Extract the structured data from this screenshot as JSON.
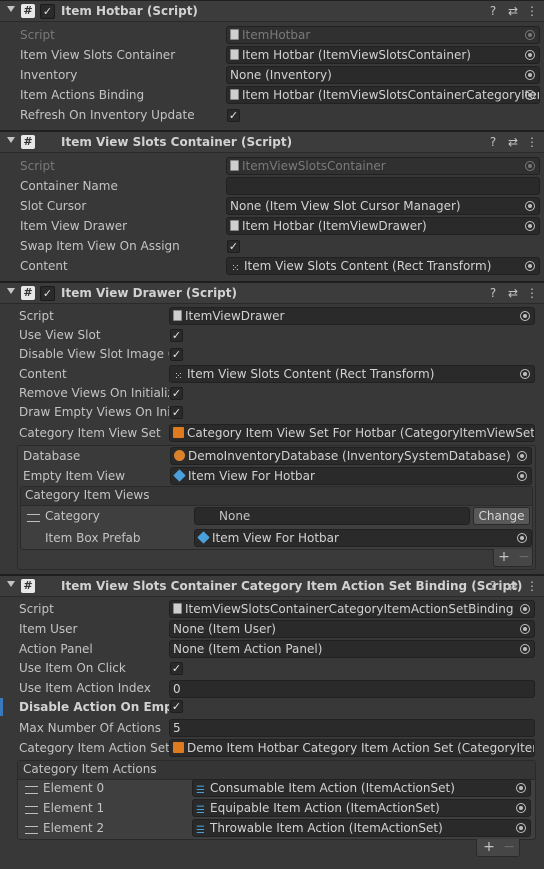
{
  "c1": {
    "title": "Item Hotbar (Script)",
    "rows": [
      {
        "label": "Script",
        "value": "ItemHotbar"
      },
      {
        "label": "Item View Slots Container",
        "value": "Item Hotbar (ItemViewSlotsContainer)"
      },
      {
        "label": "Inventory",
        "value": "None (Inventory)"
      },
      {
        "label": "Item Actions Binding",
        "value": "Item Hotbar (ItemViewSlotsContainerCategoryItem"
      },
      {
        "label": "Refresh On Inventory Update",
        "value": "✓"
      }
    ]
  },
  "c2": {
    "title": "Item View Slots Container (Script)",
    "rows": [
      {
        "label": "Script",
        "value": "ItemViewSlotsContainer"
      },
      {
        "label": "Container Name",
        "value": ""
      },
      {
        "label": "Slot Cursor",
        "value": "None (Item View Slot Cursor Manager)"
      },
      {
        "label": "Item View Drawer",
        "value": "Item Hotbar (ItemViewDrawer)"
      },
      {
        "label": "Swap Item View On Assign",
        "value": "✓"
      },
      {
        "label": "Content",
        "value": "Item View Slots Content (Rect Transform)"
      }
    ]
  },
  "c3": {
    "title": "Item View Drawer (Script)",
    "rows": [
      {
        "label": "Script",
        "value": "ItemViewDrawer"
      },
      {
        "label": "Use View Slot",
        "value": "✓"
      },
      {
        "label": "Disable View Slot Image Co",
        "value": "✓"
      },
      {
        "label": "Content",
        "value": "Item View Slots Content (Rect Transform)"
      },
      {
        "label": "Remove Views On Initialize",
        "value": "✓"
      },
      {
        "label": "Draw Empty Views On Initia",
        "value": "✓"
      },
      {
        "label": "Category Item View Set",
        "value": "Category Item View Set For Hotbar (CategoryItemViewSet)"
      }
    ],
    "sub": {
      "database_label": "Database",
      "database_value": "DemoInventoryDatabase (InventorySystemDatabase)",
      "empty_label": "Empty Item View",
      "empty_value": "Item View For Hotbar",
      "list_title": "Category Item Views",
      "category_label": "Category",
      "category_value": "None",
      "change_label": "Change",
      "prefab_label": "Item Box Prefab",
      "prefab_value": "Item View For Hotbar"
    },
    "plus": "+",
    "minus": "−"
  },
  "c4": {
    "title": "Item View Slots Container Category Item Action Set Binding (Script)",
    "rows": [
      {
        "label": "Script",
        "value": "ItemViewSlotsContainerCategoryItemActionSetBinding"
      },
      {
        "label": "Item User",
        "value": "None (Item User)"
      },
      {
        "label": "Action Panel",
        "value": "None (Item Action Panel)"
      },
      {
        "label": "Use Item On Click",
        "value": "✓"
      },
      {
        "label": "Use Item Action Index",
        "value": "0"
      },
      {
        "label": "Disable Action On Empty S",
        "value": "✓"
      },
      {
        "label": "Max Number Of Actions",
        "value": "5"
      },
      {
        "label": "Category Item Action Set",
        "value": "Demo Item Hotbar Category Item Action Set (CategoryItemA"
      }
    ],
    "list_title": "Category Item Actions",
    "elements": [
      {
        "label": "Element 0",
        "value": "Consumable Item Action (ItemActionSet)"
      },
      {
        "label": "Element 1",
        "value": "Equipable Item Action (ItemActionSet)"
      },
      {
        "label": "Element 2",
        "value": "Throwable Item Action (ItemActionSet)"
      }
    ],
    "plus": "+",
    "minus": "−"
  },
  "header_icons": {
    "cs": "#",
    "check": "✓",
    "help": "?",
    "presets": "⇄",
    "menu": "⋮"
  },
  "colors": {
    "background": "#383838",
    "field": "#2a2a2a",
    "text": "#c4c4c4",
    "selection_bar": "#3a79bb"
  }
}
